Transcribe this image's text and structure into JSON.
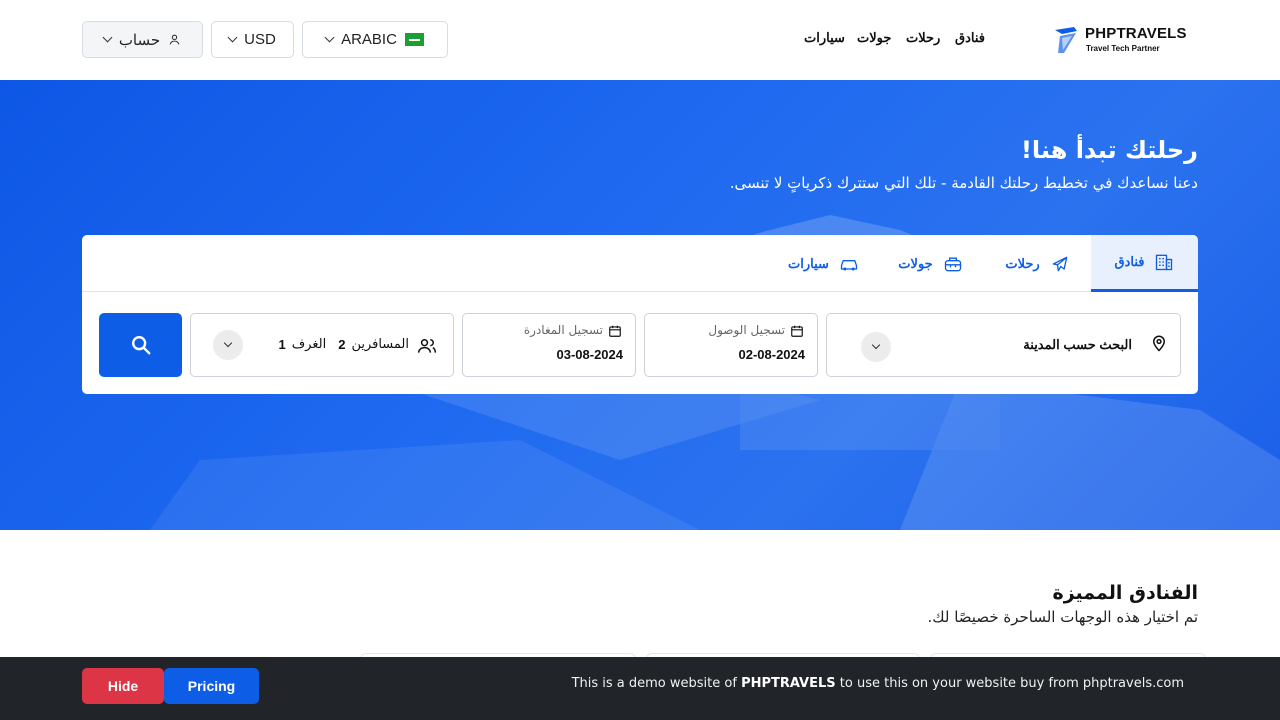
{
  "brand": {
    "name": "PHPTRAVELS",
    "tagline": "Travel Tech Partner",
    "color": "#0d5de6"
  },
  "nav": {
    "hotels": "فنادق",
    "flights": "رحلات",
    "tours": "جولات",
    "cars": "سيارات"
  },
  "header_controls": {
    "language": "ARABIC",
    "currency": "USD",
    "account": "حساب",
    "icons": [
      "saudi-flag-icon",
      "chevron-down-icon",
      "user-icon"
    ]
  },
  "hero": {
    "title": "رحلتك تبدأ هنا!",
    "subtitle": "دعنا نساعدك في تخطيط رحلتك القادمة - تلك التي ستترك ذكرياتٍ لا تنسى."
  },
  "search": {
    "tabs": [
      {
        "label": "فنادق",
        "icon": "hotel-building-icon",
        "active": true
      },
      {
        "label": "رحلات",
        "icon": "airplane-icon",
        "active": false
      },
      {
        "label": "جولات",
        "icon": "tour-bag-icon",
        "active": false
      },
      {
        "label": "سيارات",
        "icon": "car-icon",
        "active": false
      }
    ],
    "city_placeholder": "البحث حسب المدينة",
    "checkin_label": "تسجيل الوصول",
    "checkin_value": "02-08-2024",
    "checkout_label": "تسجيل المغادرة",
    "checkout_value": "03-08-2024",
    "travellers_label": "المسافرين",
    "travellers_count": "2",
    "rooms_label": "الغرف",
    "rooms_count": "1"
  },
  "featured": {
    "title": "الفنادق المميزة",
    "subtitle": "تم اختيار هذه الوجهات الساحرة خصيصًا لك."
  },
  "demo_bar": {
    "text_before": "This is a demo website of",
    "brand": "PHPTRAVELS",
    "text_after": "to use this on your website buy from phptravels.com",
    "hide_label": "Hide",
    "pricing_label": "Pricing",
    "hide_color": "#dc3545",
    "pricing_color": "#0d5de6"
  }
}
